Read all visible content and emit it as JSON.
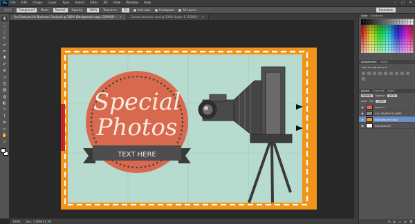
{
  "menubar": {
    "logo": "Ps",
    "items": [
      "File",
      "Edit",
      "Image",
      "Layer",
      "Type",
      "Select",
      "Filter",
      "3D",
      "View",
      "Window",
      "Help"
    ],
    "window_controls": [
      "–",
      "□",
      "✕"
    ]
  },
  "options": {
    "sample_label": "Foreground",
    "mode_label": "Mode:",
    "mode_value": "Normal",
    "opacity_label": "Opacity:",
    "opacity_value": "100%",
    "tolerance_label": "Tolerance:",
    "tolerance_value": "32",
    "antialias_label": "Anti-alias",
    "contiguous_label": "Contiguous",
    "all_layers_label": "All Layers",
    "workspace": "Essentials"
  },
  "tabs": [
    {
      "label": "Fun Features for Business Card.psd @ 100% (Background copy, CMYK/8) *",
      "active": true
    },
    {
      "label": "Canvas business card @ 100% (Layer 1, RGB/8) *",
      "active": false
    }
  ],
  "tools": [
    "move",
    "marquee",
    "lasso",
    "quick-select",
    "crop",
    "eyedropper",
    "spot-heal",
    "brush",
    "clone-stamp",
    "history-brush",
    "eraser",
    "gradient",
    "blur",
    "dodge",
    "pen",
    "type",
    "path-select",
    "shape",
    "hand",
    "zoom"
  ],
  "tool_glyphs": [
    "✥",
    "⬚",
    "◌",
    "✎",
    "⌗",
    "✒",
    "✚",
    "✐",
    "⎈",
    "↺",
    "◫",
    "▤",
    "◍",
    "◐",
    "✑",
    "T",
    "➤",
    "▭",
    "✋",
    "⌕"
  ],
  "document": {
    "headline_line1": "Special",
    "headline_line2": "Photos",
    "banner_text": "TEXT HERE",
    "colors": {
      "frame": "#f29419",
      "card_bg": "#b7dccf",
      "circle": "#d9694e",
      "banner": "#4d4d4d",
      "red_tab": "#c9262b"
    }
  },
  "status": {
    "zoom": "100%",
    "doc_size": "Doc: 1.06M/11.1M"
  },
  "panels": {
    "color_tabs": [
      "Color",
      "Swatches"
    ],
    "adjustments_tabs": [
      "Adjustments",
      "Styles"
    ],
    "adjustments_title": "Add an adjustment",
    "layers_tabs": [
      "Layers",
      "Channels",
      "Paths"
    ],
    "blend_mode": "Normal",
    "opacity_label": "Opacity:",
    "opacity_value": "100%",
    "lock_label": "Lock:",
    "fill_label": "Fill:",
    "fill_value": "100%",
    "layers": [
      {
        "name": "Layer 1",
        "selected": false,
        "thumb": "#d9694e"
      },
      {
        "name": "ALL GRAPHICS HERE",
        "selected": false,
        "thumb": "#8a8a8a"
      },
      {
        "name": "Background copy",
        "selected": true,
        "thumb": "#f29419"
      },
      {
        "name": "Background",
        "selected": false,
        "thumb": "#ffffff"
      }
    ],
    "layer_bottom_icons": [
      "fx",
      "◐",
      "▭",
      "▤",
      "🗑"
    ]
  }
}
